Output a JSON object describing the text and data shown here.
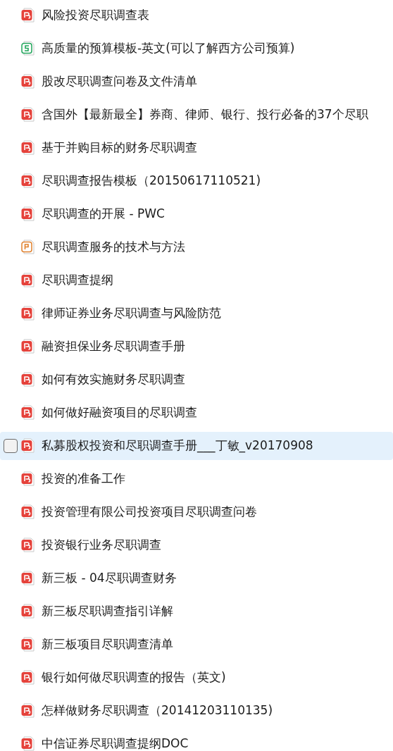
{
  "files": [
    {
      "name": "风险投资尽职调查表",
      "kind": "pdf",
      "selected": false
    },
    {
      "name": "高质量的预算模板-英文(可以了解西方公司预算)",
      "kind": "sheet",
      "selected": false
    },
    {
      "name": "股改尽职调查问卷及文件清单",
      "kind": "pdf",
      "selected": false
    },
    {
      "name": "含国外【最新最全】券商、律师、银行、投行必备的37个尽职",
      "kind": "pdf",
      "selected": false
    },
    {
      "name": "基于并购目标的财务尽职调查",
      "kind": "pdf",
      "selected": false
    },
    {
      "name": "尽职调查报告模板（20150617110521)",
      "kind": "pdf",
      "selected": false
    },
    {
      "name": "尽职调查的开展 - PWC",
      "kind": "pdf",
      "selected": false
    },
    {
      "name": "尽职调查服务的技术与方法",
      "kind": "slides",
      "selected": false
    },
    {
      "name": "尽职调查提纲",
      "kind": "pdf",
      "selected": false
    },
    {
      "name": "律师证券业务尽职调查与风险防范",
      "kind": "pdf",
      "selected": false
    },
    {
      "name": "融资担保业务尽职调查手册",
      "kind": "pdf",
      "selected": false
    },
    {
      "name": "如何有效实施财务尽职调查",
      "kind": "pdf",
      "selected": false
    },
    {
      "name": "如何做好融资项目的尽职调查",
      "kind": "pdf",
      "selected": false
    },
    {
      "name": "私募股权投资和尽职调查手册___丁敏_v20170908",
      "kind": "pdf",
      "selected": true
    },
    {
      "name": "投资的准备工作",
      "kind": "pdf",
      "selected": false
    },
    {
      "name": "投资管理有限公司投资项目尽职调查问卷",
      "kind": "pdf",
      "selected": false
    },
    {
      "name": "投资银行业务尽职调查",
      "kind": "pdf",
      "selected": false
    },
    {
      "name": "新三板 - 04尽职调查财务",
      "kind": "pdf",
      "selected": false
    },
    {
      "name": "新三板尽职调查指引详解",
      "kind": "pdf",
      "selected": false
    },
    {
      "name": "新三板项目尽职调查清单",
      "kind": "pdf",
      "selected": false
    },
    {
      "name": "银行如何做尽职调查的报告（英文)",
      "kind": "pdf",
      "selected": false
    },
    {
      "name": "怎样做财务尽职调查（20141203110135)",
      "kind": "pdf",
      "selected": false
    },
    {
      "name": "中信证券尽职调查提纲DOC",
      "kind": "pdf",
      "selected": false
    }
  ]
}
